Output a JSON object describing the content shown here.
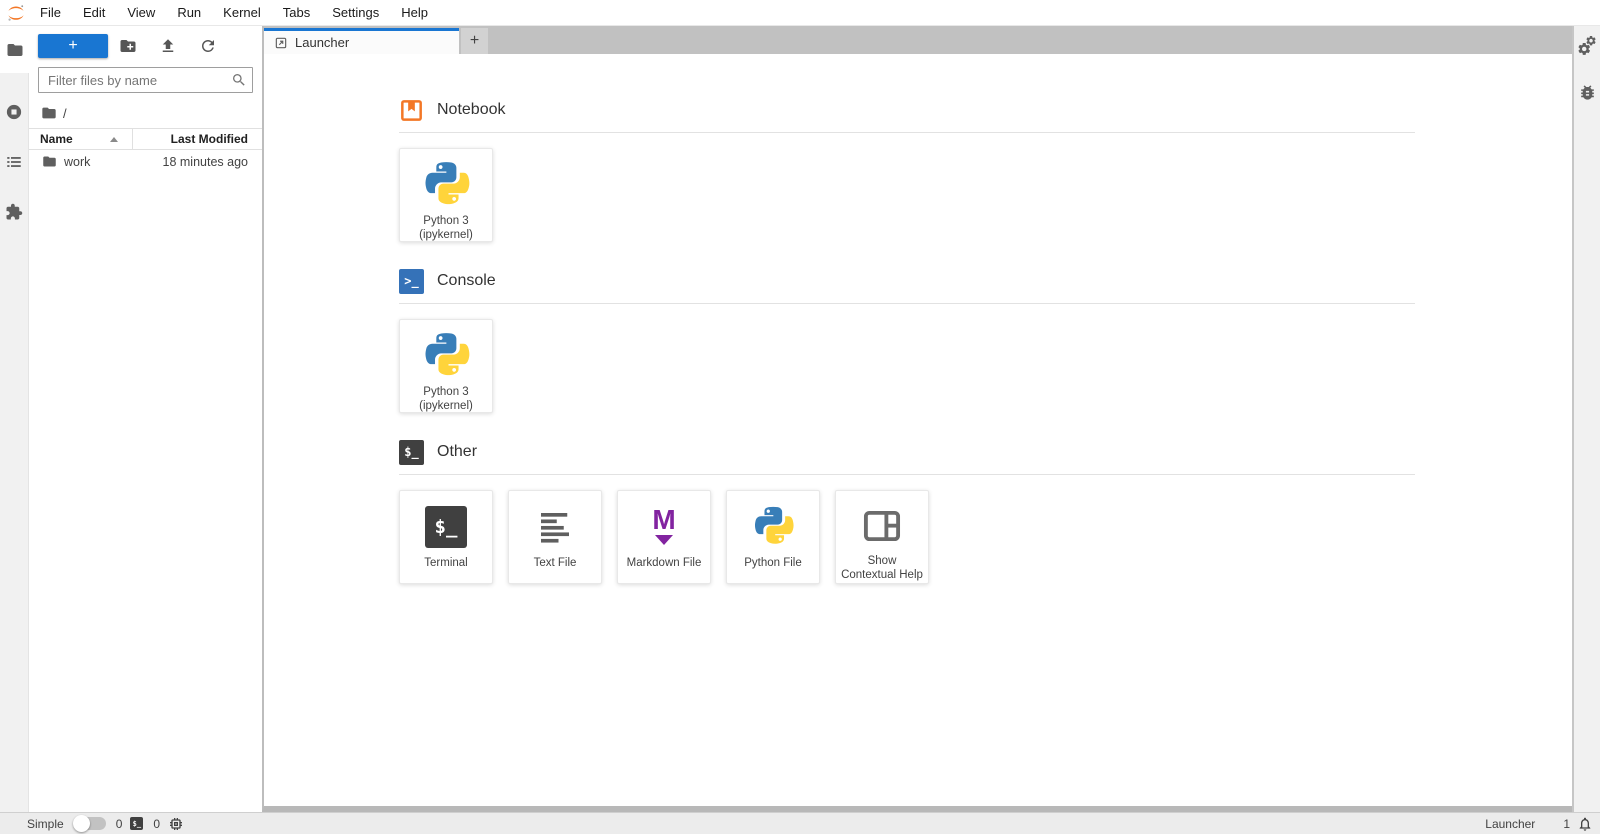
{
  "menu": {
    "items": [
      "File",
      "Edit",
      "View",
      "Run",
      "Kernel",
      "Tabs",
      "Settings",
      "Help"
    ]
  },
  "file_browser": {
    "new_launcher_label": "+",
    "filter_placeholder": "Filter files by name",
    "breadcrumb_root": "/",
    "columns": {
      "name": "Name",
      "modified": "Last Modified"
    },
    "rows": [
      {
        "name": "work",
        "modified": "18 minutes ago"
      }
    ]
  },
  "launcher": {
    "tab_label": "Launcher",
    "new_tab_label": "+",
    "sections": [
      {
        "title": "Notebook",
        "cards": [
          {
            "label": "Python 3 (ipykernel)",
            "icon": "python-logo"
          }
        ]
      },
      {
        "title": "Console",
        "cards": [
          {
            "label": "Python 3 (ipykernel)",
            "icon": "python-logo"
          }
        ]
      },
      {
        "title": "Other",
        "cards": [
          {
            "label": "Terminal",
            "icon": "terminal"
          },
          {
            "label": "Text File",
            "icon": "text-lines"
          },
          {
            "label": "Markdown File",
            "icon": "markdown"
          },
          {
            "label": "Python File",
            "icon": "python-logo"
          },
          {
            "label": "Show Contextual Help",
            "icon": "inspector-panel"
          }
        ]
      }
    ]
  },
  "icons": {
    "terminal_glyph": "$_",
    "console_glyph": ">_",
    "markdown_glyph": "M"
  },
  "status_bar": {
    "mode_label": "Simple",
    "terminals_count": "0",
    "kernels_count": "0",
    "context": "Launcher",
    "notifications_count": "1"
  },
  "colors": {
    "accent_blue": "#1976d2",
    "jupyter_orange": "#F37726",
    "console_blue": "#3572b8",
    "terminal_dark": "#404040",
    "markdown_purple": "#8223a0",
    "python_blue": "#387EB8",
    "python_yellow": "#FFD43B",
    "tabbar_gray": "#c1c1c1"
  }
}
